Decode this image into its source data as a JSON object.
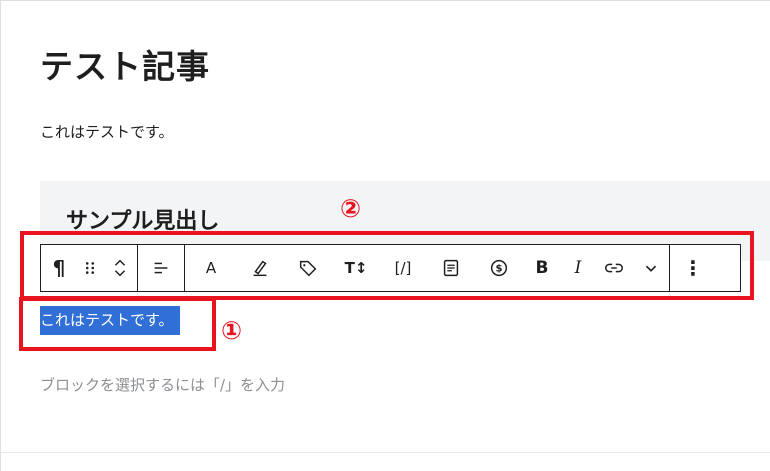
{
  "post": {
    "title": "テスト記事",
    "paragraph1": "これはテストです。",
    "heading": "サンプル見出し",
    "selected_paragraph": "これはテストです。",
    "block_placeholder": "ブロックを選択するには「/」を入力"
  },
  "annotations": {
    "label_one": "①",
    "label_two": "②",
    "color": "#e8141f"
  },
  "toolbar": {
    "paragraph_icon": "¶",
    "align_icon": "align-left-icon",
    "text_color_label": "A",
    "font_size_label": "T↕",
    "code_label": "[/]",
    "bold_label": "B",
    "italic_label": "I",
    "more_icon": "⋮"
  }
}
